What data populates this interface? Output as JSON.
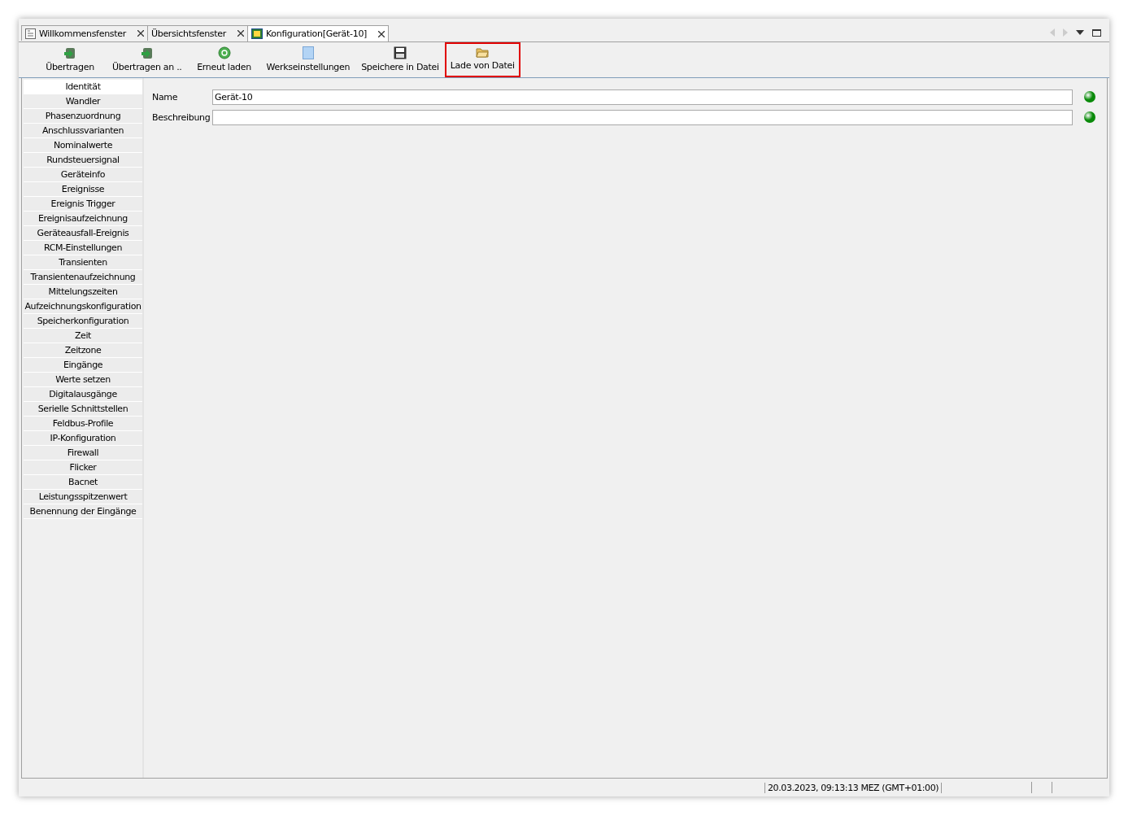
{
  "tabs": [
    {
      "label": "Willkommensfenster",
      "kind": "document",
      "selected": false
    },
    {
      "label": "Übersichtsfenster",
      "kind": "plain",
      "selected": false
    },
    {
      "label": "Konfiguration[Gerät-10]",
      "kind": "config",
      "selected": true
    }
  ],
  "toolbar": [
    {
      "label": "Übertragen",
      "kind": "transfer",
      "highlighted": false
    },
    {
      "label": "Übertragen an ..",
      "kind": "transfer",
      "highlighted": false
    },
    {
      "label": "Erneut laden",
      "kind": "reload",
      "highlighted": false
    },
    {
      "label": "Werkseinstellungen",
      "kind": "factory",
      "highlighted": false
    },
    {
      "label": "Speichere in Datei",
      "kind": "save",
      "highlighted": false
    },
    {
      "label": "Lade von Datei",
      "kind": "folder",
      "highlighted": true
    }
  ],
  "sidebar": {
    "items": [
      {
        "label": "Identität",
        "selected": true
      },
      {
        "label": "Wandler",
        "selected": false
      },
      {
        "label": "Phasenzuordnung",
        "selected": false
      },
      {
        "label": "Anschlussvarianten",
        "selected": false
      },
      {
        "label": "Nominalwerte",
        "selected": false
      },
      {
        "label": "Rundsteuersignal",
        "selected": false
      },
      {
        "label": "Geräteinfo",
        "selected": false
      },
      {
        "label": "Ereignisse",
        "selected": false
      },
      {
        "label": "Ereignis Trigger",
        "selected": false
      },
      {
        "label": "Ereignisaufzeichnung",
        "selected": false
      },
      {
        "label": "Geräteausfall-Ereignis",
        "selected": false
      },
      {
        "label": "RCM-Einstellungen",
        "selected": false
      },
      {
        "label": "Transienten",
        "selected": false
      },
      {
        "label": "Transientenaufzeichnung",
        "selected": false
      },
      {
        "label": "Mittelungszeiten",
        "selected": false
      },
      {
        "label": "Aufzeichnungskonfiguration",
        "selected": false
      },
      {
        "label": "Speicherkonfiguration",
        "selected": false
      },
      {
        "label": "Zeit",
        "selected": false
      },
      {
        "label": "Zeitzone",
        "selected": false
      },
      {
        "label": "Eingänge",
        "selected": false
      },
      {
        "label": "Werte setzen",
        "selected": false
      },
      {
        "label": "Digitalausgänge",
        "selected": false
      },
      {
        "label": "Serielle Schnittstellen",
        "selected": false
      },
      {
        "label": "Feldbus-Profile",
        "selected": false
      },
      {
        "label": "IP-Konfiguration",
        "selected": false
      },
      {
        "label": "Firewall",
        "selected": false
      },
      {
        "label": "Flicker",
        "selected": false
      },
      {
        "label": "Bacnet",
        "selected": false
      },
      {
        "label": "Leistungsspitzenwert",
        "selected": false
      },
      {
        "label": "Benennung der Eingänge",
        "selected": false
      }
    ]
  },
  "form": {
    "fields": [
      {
        "label": "Name",
        "value": "Gerät-10",
        "color": "#0a8a0a"
      },
      {
        "label": "Beschreibung",
        "color": "#0a8a0a"
      }
    ]
  },
  "status_bar": {
    "datetime": "20.03.2023, 09:13:13 MEZ (GMT+01:00)"
  }
}
